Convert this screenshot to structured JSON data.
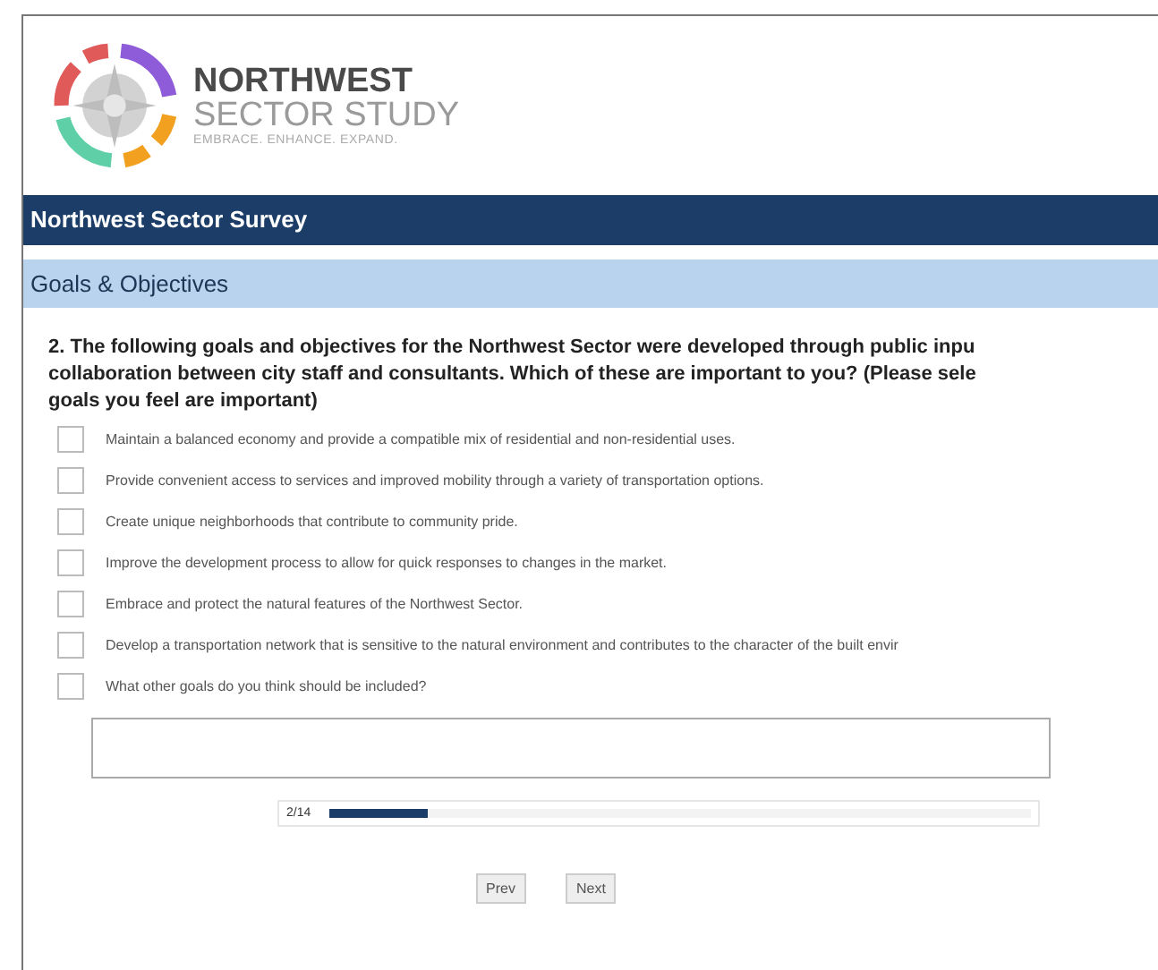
{
  "logo": {
    "title": "NORTHWEST",
    "subtitle": "SECTOR STUDY",
    "tagline": "EMBRACE. ENHANCE. EXPAND."
  },
  "survey_title": "Northwest Sector Survey",
  "section_title": "Goals & Objectives",
  "question_lines": [
    "2. The following goals and objectives for the Northwest Sector were developed through public inpu",
    "collaboration between city staff and consultants. Which of these are important to you? (Please sele",
    "goals you feel are important)"
  ],
  "options": [
    {
      "label": "Maintain a balanced economy and provide a compatible mix of residential and non-residential uses.",
      "checked": false
    },
    {
      "label": "Provide convenient access to services and improved mobility through a variety of transportation options.",
      "checked": false
    },
    {
      "label": "Create unique neighborhoods that contribute to community pride.",
      "checked": false
    },
    {
      "label": "Improve the development process to allow for quick responses to changes in the market.",
      "checked": false
    },
    {
      "label": "Embrace and protect the natural features of the Northwest Sector.",
      "checked": false
    },
    {
      "label": "Develop a transportation network that is sensitive to the natural environment and contributes to the character of the built envir",
      "checked": false
    },
    {
      "label": "What other goals do you think should be included?",
      "checked": false
    }
  ],
  "progress": {
    "label": "2/14",
    "level": 0.14
  },
  "buttons": [
    "Prev",
    "Next"
  ]
}
